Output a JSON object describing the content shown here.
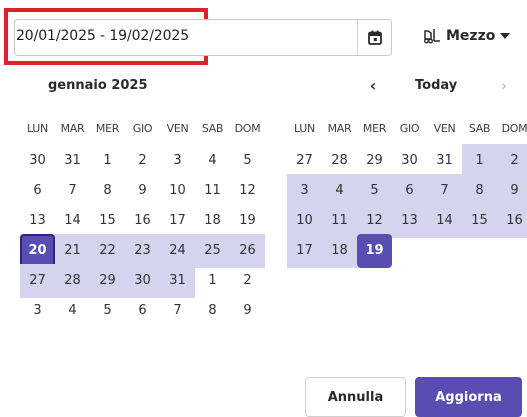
{
  "date_range": {
    "value": "20/01/2025 - 19/02/2025"
  },
  "vehicle_filter": {
    "label": "Mezzo",
    "icon": "forklift-icon"
  },
  "calendar": {
    "left_month_title": "gennaio 2025",
    "prev_label": "‹",
    "today_label": "Today",
    "next_label": "›",
    "weekdays": [
      "LUN",
      "MAR",
      "MER",
      "GIO",
      "VEN",
      "SAB",
      "DOM"
    ],
    "left_days": [
      [
        {
          "d": "30",
          "s": ""
        },
        {
          "d": "31",
          "s": ""
        },
        {
          "d": "1",
          "s": ""
        },
        {
          "d": "2",
          "s": ""
        },
        {
          "d": "3",
          "s": ""
        },
        {
          "d": "4",
          "s": ""
        },
        {
          "d": "5",
          "s": ""
        }
      ],
      [
        {
          "d": "6",
          "s": ""
        },
        {
          "d": "7",
          "s": ""
        },
        {
          "d": "8",
          "s": ""
        },
        {
          "d": "9",
          "s": ""
        },
        {
          "d": "10",
          "s": ""
        },
        {
          "d": "11",
          "s": ""
        },
        {
          "d": "12",
          "s": ""
        }
      ],
      [
        {
          "d": "13",
          "s": ""
        },
        {
          "d": "14",
          "s": ""
        },
        {
          "d": "15",
          "s": ""
        },
        {
          "d": "16",
          "s": ""
        },
        {
          "d": "17",
          "s": ""
        },
        {
          "d": "18",
          "s": ""
        },
        {
          "d": "19",
          "s": ""
        }
      ],
      [
        {
          "d": "20",
          "s": "start"
        },
        {
          "d": "21",
          "s": "range"
        },
        {
          "d": "22",
          "s": "range"
        },
        {
          "d": "23",
          "s": "range"
        },
        {
          "d": "24",
          "s": "range"
        },
        {
          "d": "25",
          "s": "range"
        },
        {
          "d": "26",
          "s": "range"
        }
      ],
      [
        {
          "d": "27",
          "s": "range"
        },
        {
          "d": "28",
          "s": "range"
        },
        {
          "d": "29",
          "s": "range"
        },
        {
          "d": "30",
          "s": "range"
        },
        {
          "d": "31",
          "s": "range"
        },
        {
          "d": "1",
          "s": ""
        },
        {
          "d": "2",
          "s": ""
        }
      ],
      [
        {
          "d": "3",
          "s": ""
        },
        {
          "d": "4",
          "s": ""
        },
        {
          "d": "5",
          "s": ""
        },
        {
          "d": "6",
          "s": ""
        },
        {
          "d": "7",
          "s": ""
        },
        {
          "d": "8",
          "s": ""
        },
        {
          "d": "9",
          "s": ""
        }
      ]
    ],
    "right_days": [
      [
        {
          "d": "27",
          "s": ""
        },
        {
          "d": "28",
          "s": ""
        },
        {
          "d": "29",
          "s": ""
        },
        {
          "d": "30",
          "s": ""
        },
        {
          "d": "31",
          "s": ""
        },
        {
          "d": "1",
          "s": "range"
        },
        {
          "d": "2",
          "s": "range"
        }
      ],
      [
        {
          "d": "3",
          "s": "range"
        },
        {
          "d": "4",
          "s": "range"
        },
        {
          "d": "5",
          "s": "range"
        },
        {
          "d": "6",
          "s": "range"
        },
        {
          "d": "7",
          "s": "range"
        },
        {
          "d": "8",
          "s": "range"
        },
        {
          "d": "9",
          "s": "range"
        }
      ],
      [
        {
          "d": "10",
          "s": "range"
        },
        {
          "d": "11",
          "s": "range"
        },
        {
          "d": "12",
          "s": "range"
        },
        {
          "d": "13",
          "s": "range"
        },
        {
          "d": "14",
          "s": "range"
        },
        {
          "d": "15",
          "s": "range"
        },
        {
          "d": "16",
          "s": "range"
        }
      ],
      [
        {
          "d": "17",
          "s": "range"
        },
        {
          "d": "18",
          "s": "range"
        },
        {
          "d": "19",
          "s": "end"
        }
      ]
    ]
  },
  "actions": {
    "cancel_label": "Annulla",
    "apply_label": "Aggiorna"
  },
  "colors": {
    "accent": "#5a4db1",
    "range_fill": "#d6d3ee",
    "highlight_outline": "#e0202a"
  }
}
